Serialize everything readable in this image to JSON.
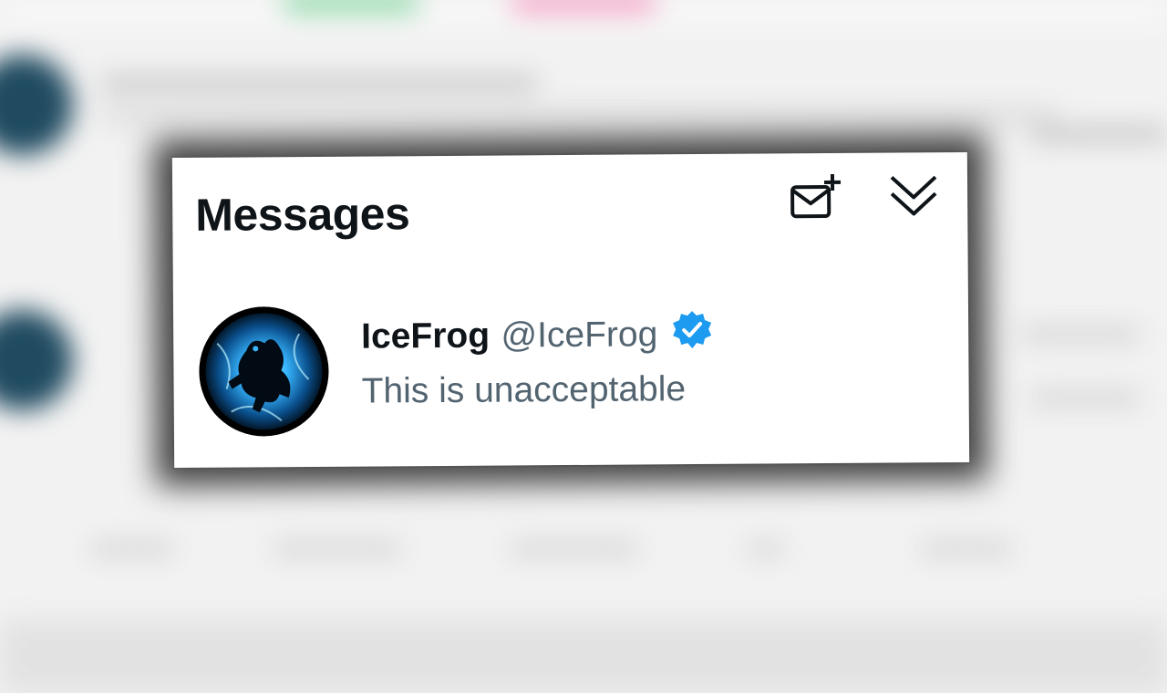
{
  "messages": {
    "title": "Messages",
    "new_message_icon": "envelope-plus-icon",
    "collapse_icon": "double-chevron-down-icon"
  },
  "conversation": {
    "display_name": "IceFrog",
    "handle": "@IceFrog",
    "verified_icon": "verified-badge-icon",
    "last_message": "This is unacceptable"
  },
  "colors": {
    "text_primary": "#0f1419",
    "text_secondary": "#536471",
    "verified": "#1d9bf0",
    "avatar_glow": "#38b6ff"
  }
}
